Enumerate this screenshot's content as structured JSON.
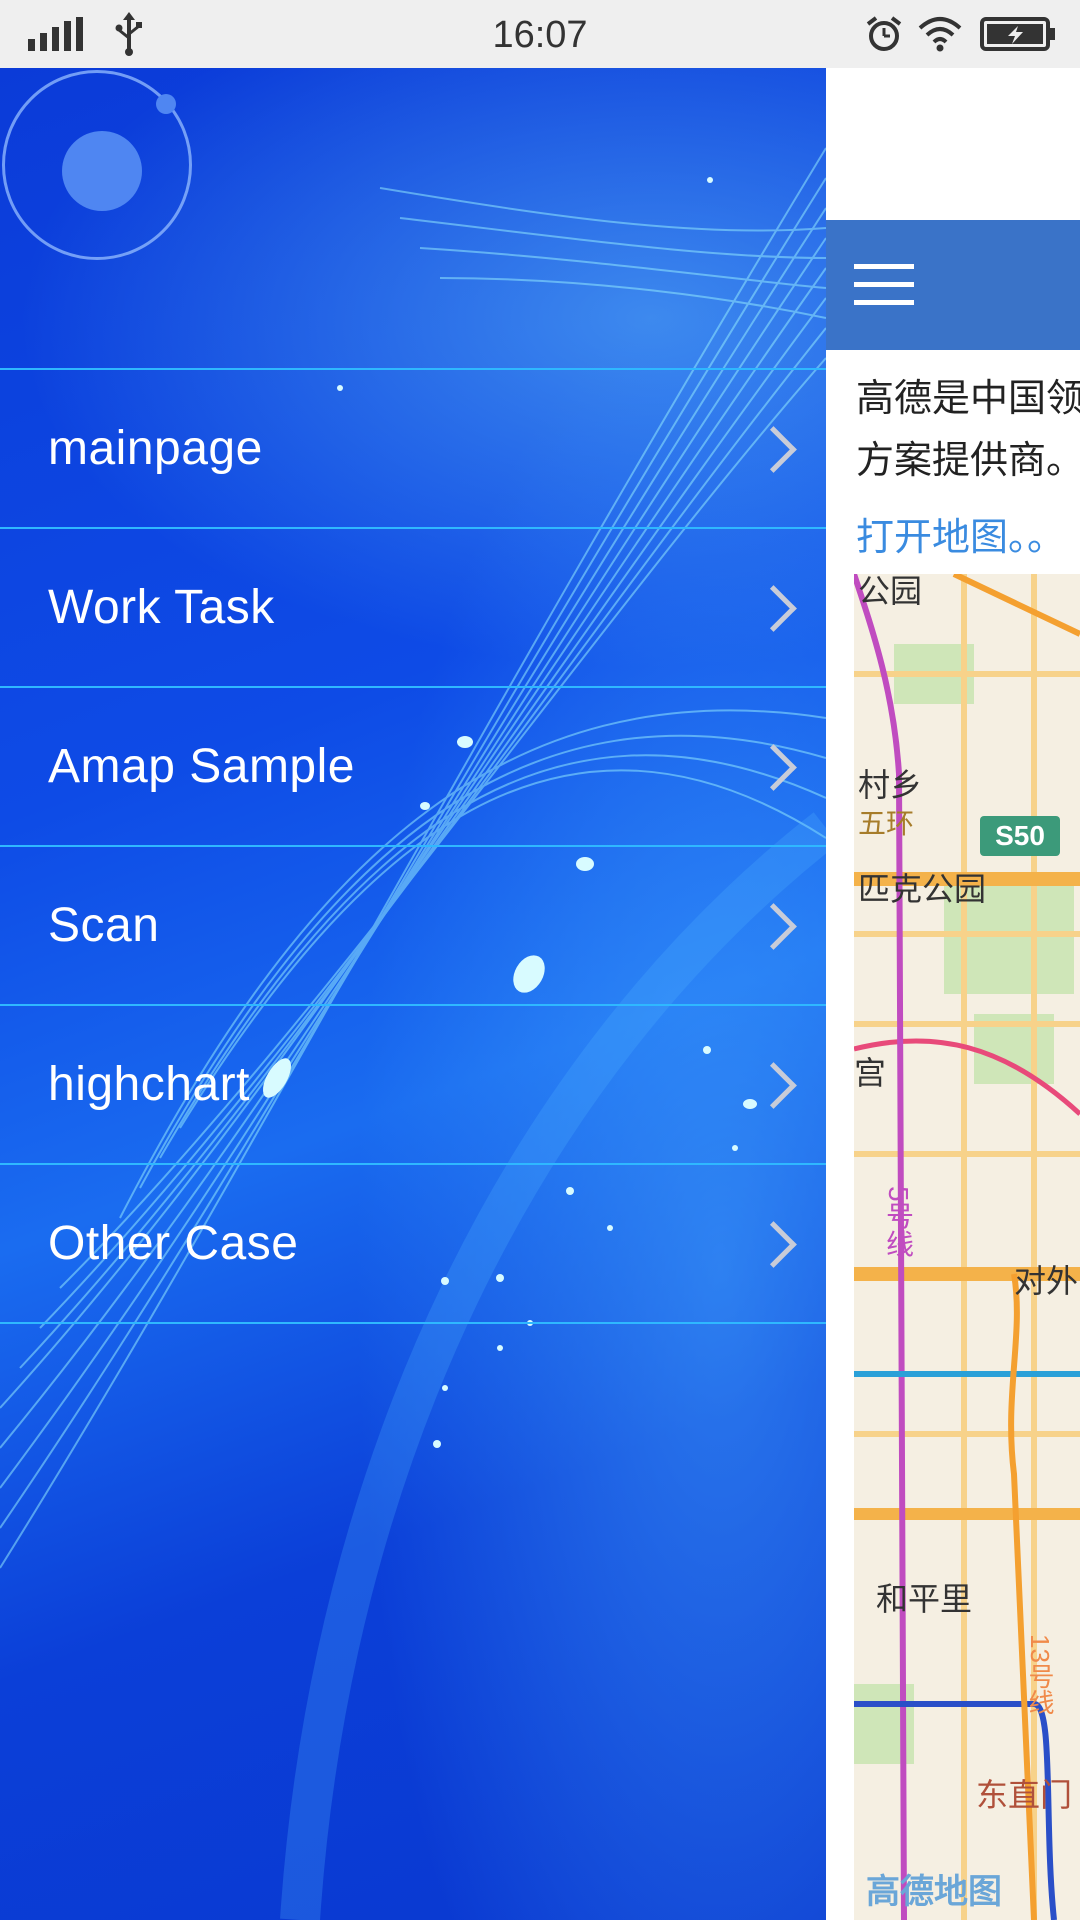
{
  "status_bar": {
    "time": "16:07",
    "icons": [
      "signal-icon",
      "usb-icon",
      "alarm-icon",
      "wifi-icon",
      "battery-charging-icon"
    ]
  },
  "drawer": {
    "menu": [
      {
        "label": "mainpage",
        "icon": "chevron-right-icon"
      },
      {
        "label": "Work Task",
        "icon": "chevron-right-icon"
      },
      {
        "label": "Amap Sample",
        "icon": "chevron-right-icon"
      },
      {
        "label": "Scan",
        "icon": "chevron-right-icon"
      },
      {
        "label": "highchart",
        "icon": "chevron-right-icon"
      },
      {
        "label": "Other Case",
        "icon": "chevron-right-icon"
      }
    ]
  },
  "main": {
    "menu_icon": "hamburger-menu-icon",
    "text_line1": "高德是中国领",
    "text_line2": "方案提供商。",
    "link": "打开地图。。",
    "map": {
      "labels": [
        "公园",
        "村乡",
        "五环",
        "匹克公园",
        "宫",
        "5号线",
        "对外",
        "和平里",
        "东直门",
        "13号线"
      ],
      "badge": "S50",
      "watermark": "高德地图"
    }
  },
  "colors": {
    "drawer_blue": "#0a3fd6",
    "divider": "#2fb8ff",
    "header_bar": "#3a73c8",
    "link": "#3a8be0"
  }
}
